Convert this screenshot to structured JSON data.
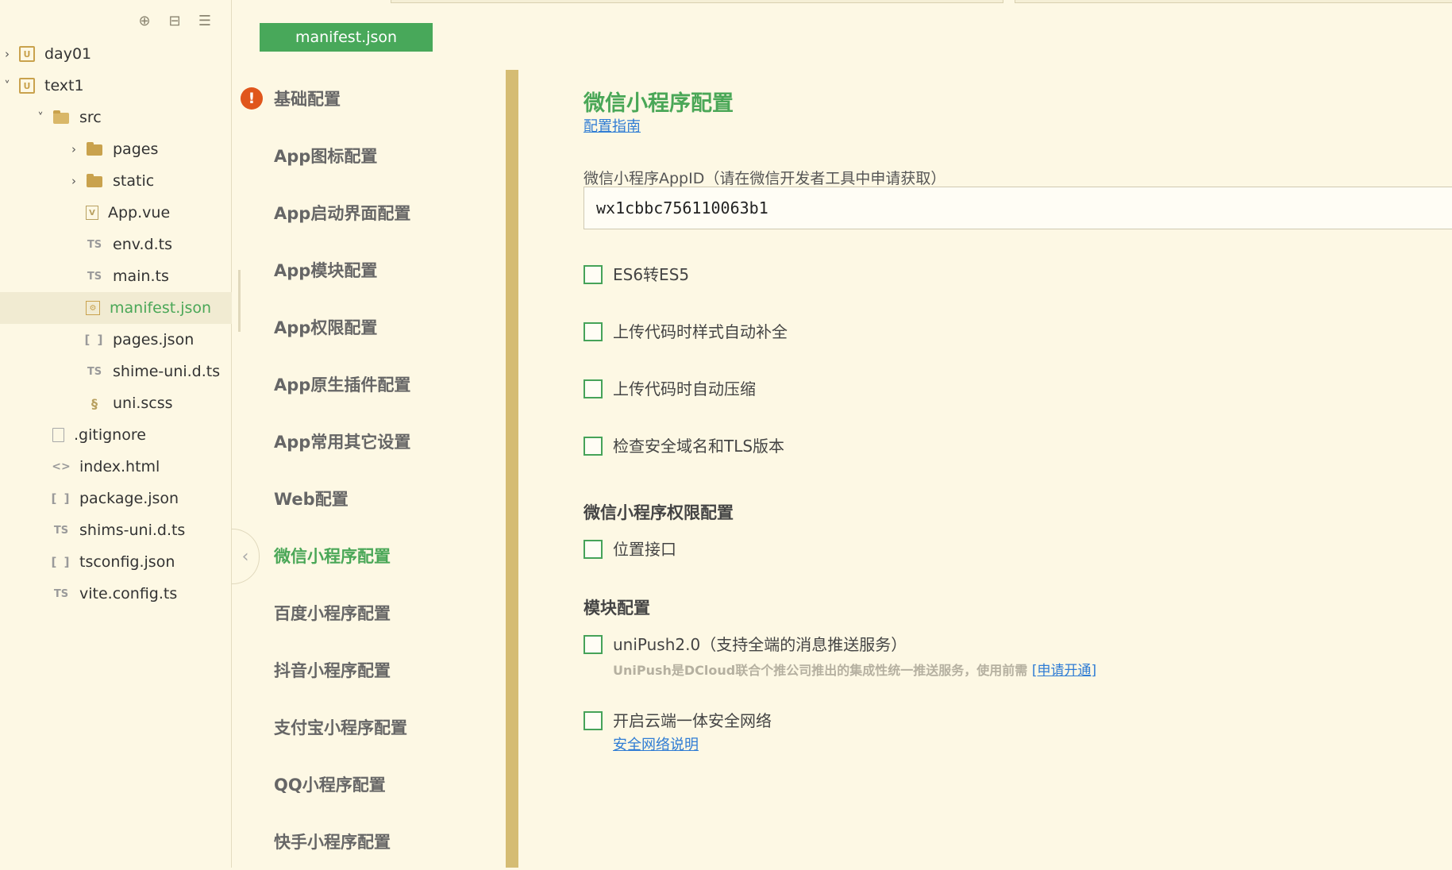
{
  "tree": {
    "items": [
      {
        "label": "day01",
        "depth": 0,
        "chevron": "›",
        "icon": "U",
        "kind": "proj"
      },
      {
        "label": "text1",
        "depth": 0,
        "chevron": "˅",
        "icon": "U",
        "kind": "proj"
      },
      {
        "label": "src",
        "depth": 1,
        "chevron": "˅",
        "icon": "",
        "kind": "folder-open"
      },
      {
        "label": "pages",
        "depth": 2,
        "chevron": "›",
        "icon": "",
        "kind": "folder"
      },
      {
        "label": "static",
        "depth": 2,
        "chevron": "›",
        "icon": "",
        "kind": "folder"
      },
      {
        "label": "App.vue",
        "depth": 2,
        "chevron": "",
        "icon": "V",
        "kind": "vue"
      },
      {
        "label": "env.d.ts",
        "depth": 2,
        "chevron": "",
        "icon": "TS",
        "kind": "ts"
      },
      {
        "label": "main.ts",
        "depth": 2,
        "chevron": "",
        "icon": "TS",
        "kind": "ts"
      },
      {
        "label": "manifest.json",
        "depth": 2,
        "chevron": "",
        "icon": "⚙",
        "kind": "manifest",
        "selected": true
      },
      {
        "label": "pages.json",
        "depth": 2,
        "chevron": "",
        "icon": "[ ]",
        "kind": "json"
      },
      {
        "label": "shime-uni.d.ts",
        "depth": 2,
        "chevron": "",
        "icon": "TS",
        "kind": "ts"
      },
      {
        "label": "uni.scss",
        "depth": 2,
        "chevron": "",
        "icon": "§",
        "kind": "scss"
      },
      {
        "label": ".gitignore",
        "depth": 1,
        "chevron": "",
        "icon": "",
        "kind": "file"
      },
      {
        "label": "index.html",
        "depth": 1,
        "chevron": "",
        "icon": "<>",
        "kind": "html"
      },
      {
        "label": "package.json",
        "depth": 1,
        "chevron": "",
        "icon": "[ ]",
        "kind": "json"
      },
      {
        "label": "shims-uni.d.ts",
        "depth": 1,
        "chevron": "",
        "icon": "TS",
        "kind": "ts"
      },
      {
        "label": "tsconfig.json",
        "depth": 1,
        "chevron": "",
        "icon": "[ ]",
        "kind": "json"
      },
      {
        "label": "vite.config.ts",
        "depth": 1,
        "chevron": "",
        "icon": "TS",
        "kind": "ts"
      }
    ]
  },
  "tools": {
    "locate": "⊕",
    "collapse": "⊟",
    "menu": "☰"
  },
  "tab": {
    "label": "manifest.json"
  },
  "nav": {
    "warning": "!",
    "items": [
      {
        "label": "基础配置",
        "warn": true
      },
      {
        "label": "App图标配置"
      },
      {
        "label": "App启动界面配置"
      },
      {
        "label": "App模块配置"
      },
      {
        "label": "App权限配置"
      },
      {
        "label": "App原生插件配置"
      },
      {
        "label": "App常用其它设置"
      },
      {
        "label": "Web配置"
      },
      {
        "label": "微信小程序配置",
        "active": true
      },
      {
        "label": "百度小程序配置"
      },
      {
        "label": "抖音小程序配置"
      },
      {
        "label": "支付宝小程序配置"
      },
      {
        "label": "QQ小程序配置"
      },
      {
        "label": "快手小程序配置"
      }
    ],
    "collapse_glyph": "‹"
  },
  "content": {
    "title": "微信小程序配置",
    "guide_link": "配置指南",
    "appid_label": "微信小程序AppID（请在微信开发者工具中申请获取）",
    "appid_value": "wx1cbbc756110063b1",
    "options": [
      "ES6转ES5",
      "上传代码时样式自动补全",
      "上传代码时自动压缩",
      "检查安全域名和TLS版本"
    ],
    "permission_title": "微信小程序权限配置",
    "permission_option": "位置接口",
    "module_title": "模块配置",
    "unipush_label": "uniPush2.0（支持全端的消息推送服务）",
    "unipush_hint": "UniPush是DCloud联合个推公司推出的集成性统一推送服务，使用前需",
    "unipush_link": "[申请开通]",
    "secure_label": "开启云端一体安全网络",
    "secure_link": "安全网络说明"
  },
  "colors": {
    "accent": "#48a85a",
    "background": "#fdf8e4",
    "divider": "#d5bc73",
    "warning": "#e0561c",
    "link": "#2f7cd4"
  }
}
